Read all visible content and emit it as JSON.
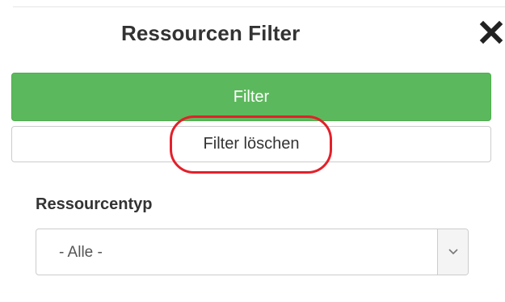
{
  "panel": {
    "title": "Ressourcen Filter",
    "close_icon": "close-icon"
  },
  "actions": {
    "filter_label": "Filter",
    "clear_label": "Filter löschen"
  },
  "resource_type": {
    "label": "Ressourcentyp",
    "selected": "- Alle -",
    "arrow_icon": "chevron-down-icon"
  },
  "colors": {
    "filter_button": "#5cb85c",
    "highlight_ring": "#e3202a",
    "text": "#333333"
  }
}
